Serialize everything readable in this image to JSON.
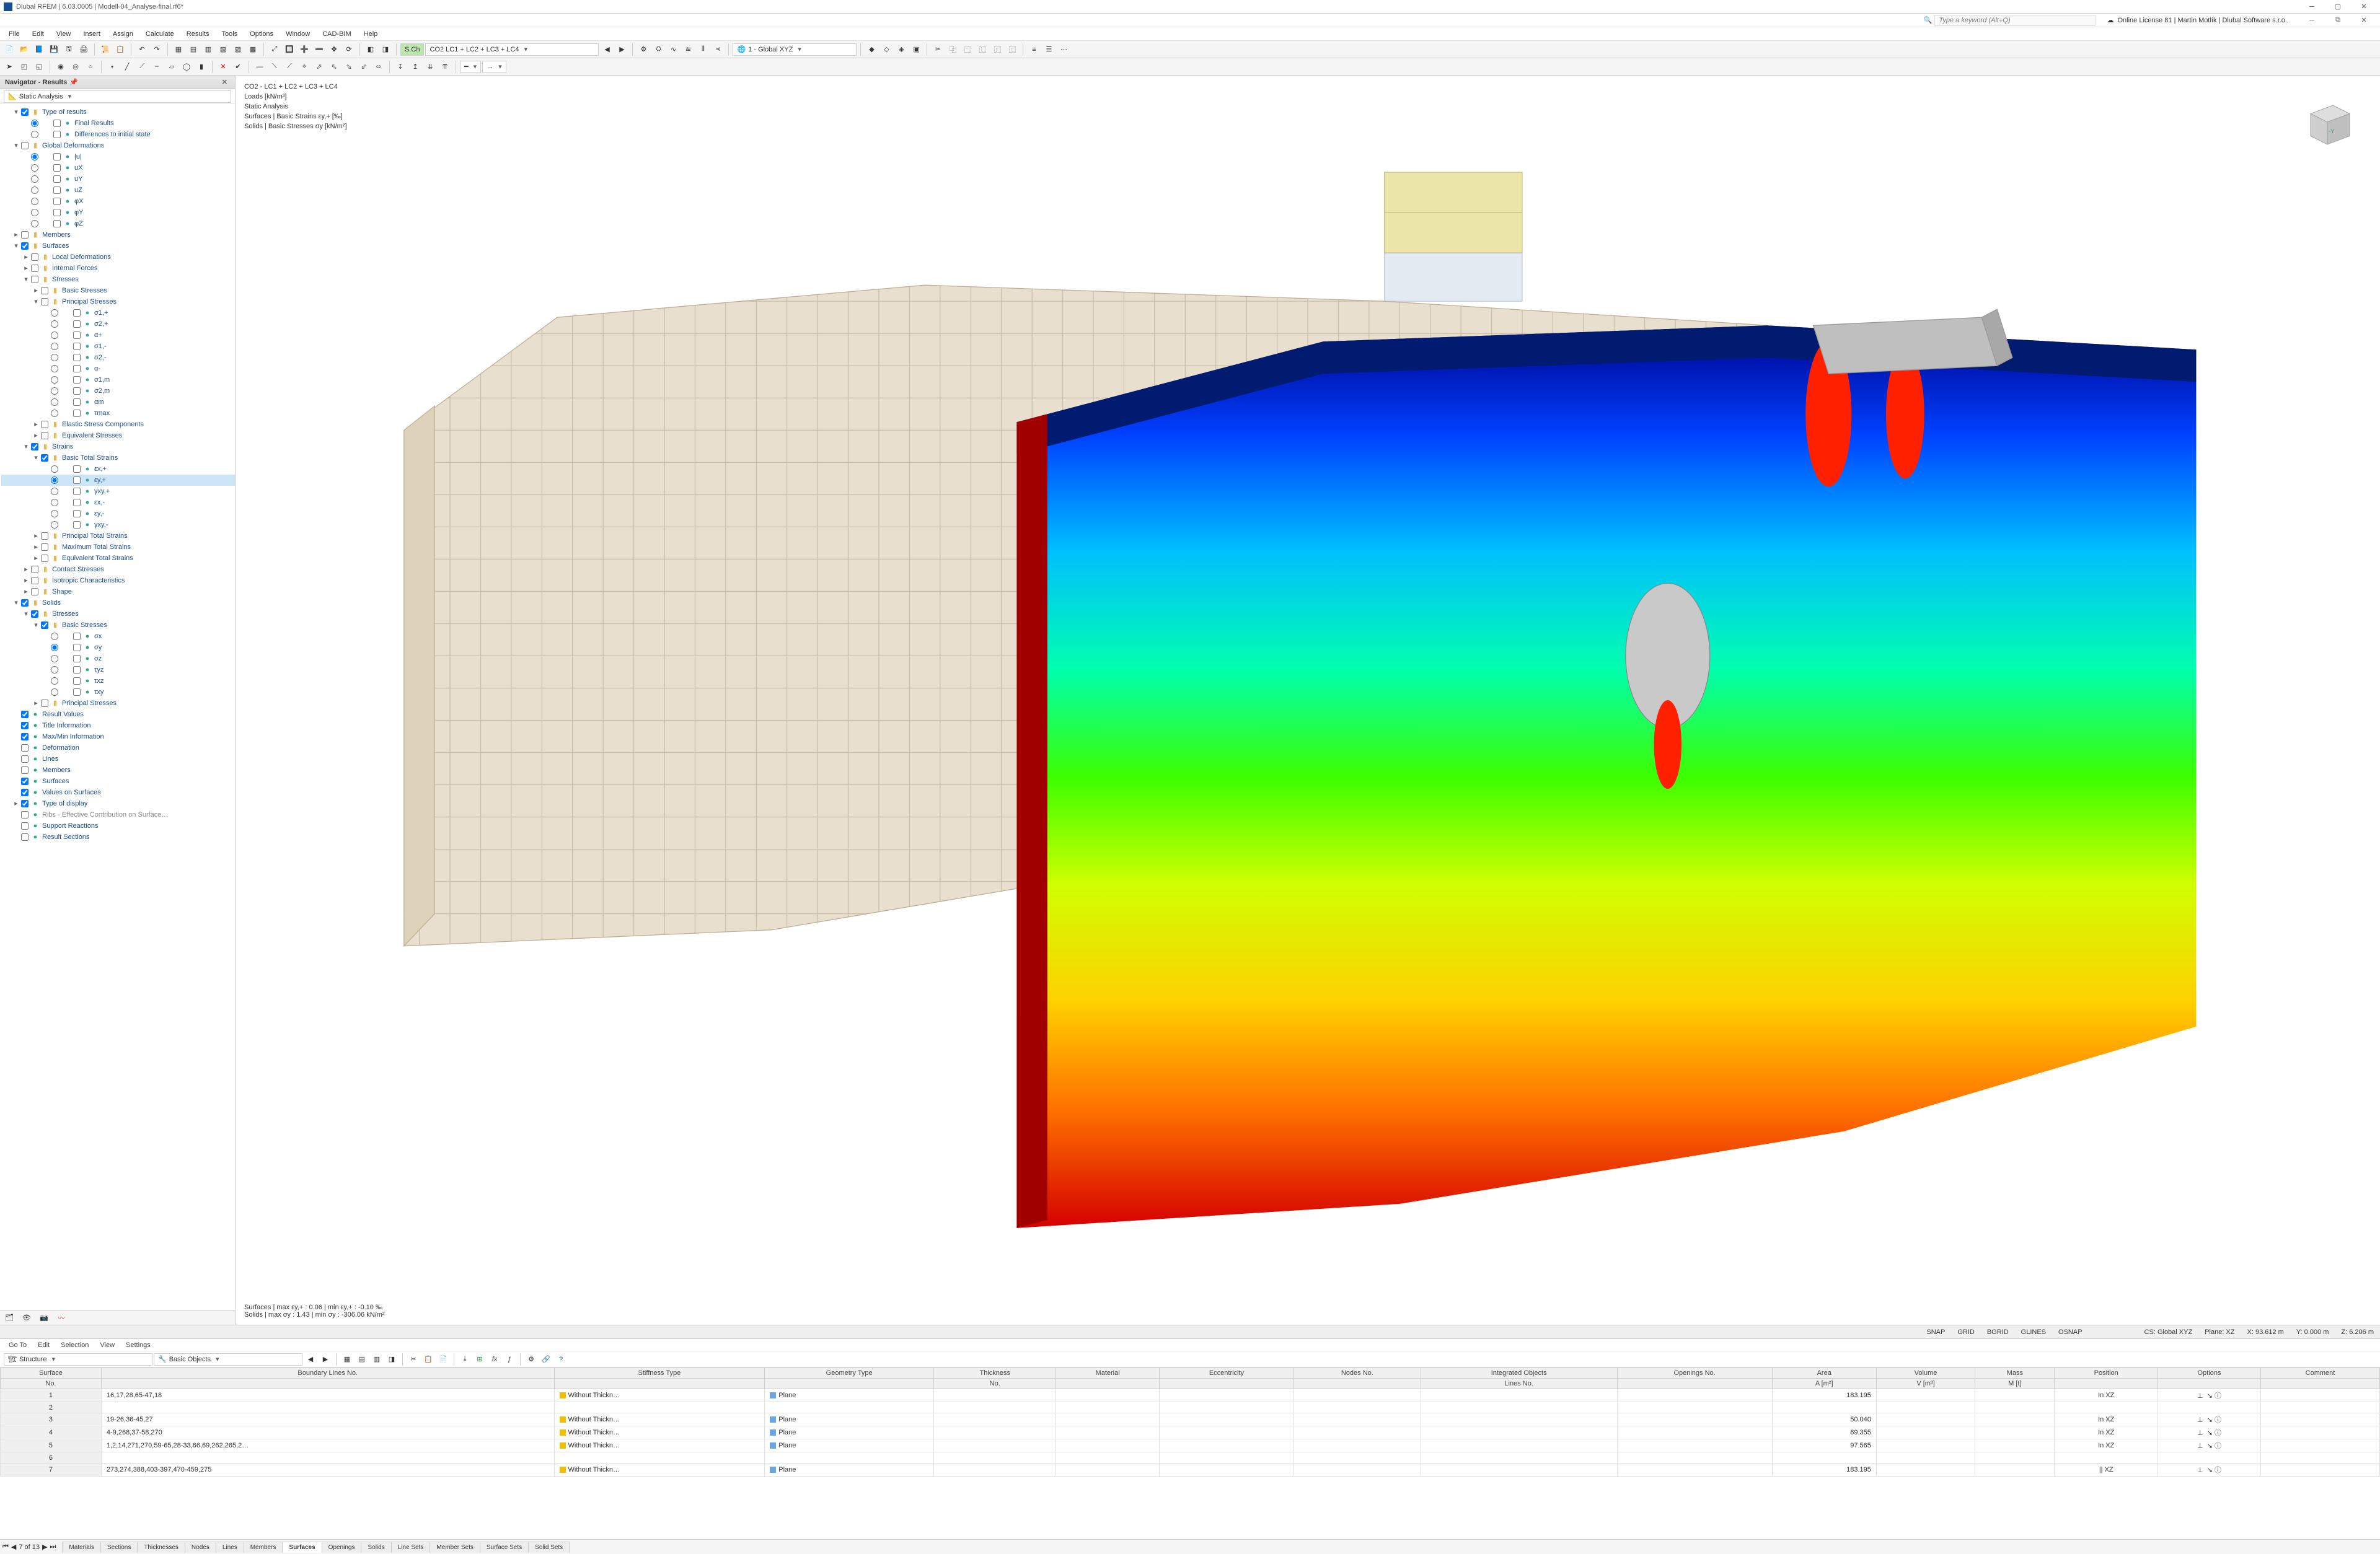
{
  "title": "Dlubal RFEM | 6.03.0005 | Modell-04_Analyse-final.rf6*",
  "subheader_icon": "rfem",
  "search_placeholder": "Type a keyword (Alt+Q)",
  "license": "Online License 81 | Martin Motlík | Dlubal Software s.r.o.",
  "menus": [
    "File",
    "Edit",
    "View",
    "Insert",
    "Assign",
    "Calculate",
    "Results",
    "Tools",
    "Options",
    "Window",
    "CAD-BIM",
    "Help"
  ],
  "combo_loadcase_prefix": "S.Ch",
  "combo_loadcase": "CO2   LC1 + LC2 + LC3 + LC4",
  "combo_coord": "1 - Global XYZ",
  "nav_title": "Navigator - Results",
  "nav_selector": "Static Analysis",
  "overlay": {
    "l1": "CO2 - LC1 + LC2 + LC3 + LC4",
    "l2": "Loads [kN/m³]",
    "l3": "Static Analysis",
    "l4": "Surfaces | Basic Strains εy,+  [‰]",
    "l5": "Solids | Basic Stresses σy  [kN/m²]"
  },
  "overlay_bottom": {
    "l1": "Surfaces | max εy,+ : 0.06 | min εy,+ : -0.10 ‰",
    "l2": "Solids | max σy : 1.43 | min σy : -306.06 kN/m²"
  },
  "tree": [
    {
      "d": 1,
      "exp": "-",
      "chk": true,
      "ic": "folder",
      "txt": "Type of results"
    },
    {
      "d": 2,
      "rad": true,
      "ic": "dot-blue",
      "txt": "Final Results"
    },
    {
      "d": 2,
      "rad": false,
      "ic": "dot-blue",
      "txt": "Differences to initial state"
    },
    {
      "d": 1,
      "exp": "-",
      "chk": false,
      "ic": "folder",
      "txt": "Global Deformations"
    },
    {
      "d": 2,
      "rad": true,
      "raddis": false,
      "txt": "|u|"
    },
    {
      "d": 2,
      "rad": false,
      "txt": "uX"
    },
    {
      "d": 2,
      "rad": false,
      "txt": "uY"
    },
    {
      "d": 2,
      "rad": false,
      "txt": "uZ"
    },
    {
      "d": 2,
      "rad": false,
      "txt": "φX"
    },
    {
      "d": 2,
      "rad": false,
      "txt": "φY"
    },
    {
      "d": 2,
      "rad": false,
      "txt": "φZ"
    },
    {
      "d": 1,
      "exp": "+",
      "chk": false,
      "ic": "folder",
      "txt": "Members"
    },
    {
      "d": 1,
      "exp": "-",
      "chk": true,
      "ic": "folder",
      "txt": "Surfaces"
    },
    {
      "d": 2,
      "exp": "+",
      "chk": false,
      "ic": "folder",
      "txt": "Local Deformations"
    },
    {
      "d": 2,
      "exp": "+",
      "chk": false,
      "ic": "folder",
      "txt": "Internal Forces"
    },
    {
      "d": 2,
      "exp": "-",
      "chk": false,
      "ic": "folder",
      "txt": "Stresses"
    },
    {
      "d": 3,
      "exp": "+",
      "chk": false,
      "ic": "folder",
      "txt": "Basic Stresses"
    },
    {
      "d": 3,
      "exp": "-",
      "chk": false,
      "ic": "folder",
      "txt": "Principal Stresses"
    },
    {
      "d": 4,
      "rad": false,
      "ic": "dot-g",
      "txt": "σ1,+"
    },
    {
      "d": 4,
      "rad": false,
      "ic": "dot-g",
      "txt": "σ2,+"
    },
    {
      "d": 4,
      "rad": false,
      "ic": "dot-g",
      "txt": "α+"
    },
    {
      "d": 4,
      "rad": false,
      "ic": "dot-g",
      "txt": "σ1,-"
    },
    {
      "d": 4,
      "rad": false,
      "ic": "dot-g",
      "txt": "σ2,-"
    },
    {
      "d": 4,
      "rad": false,
      "ic": "dot-g",
      "txt": "α-"
    },
    {
      "d": 4,
      "rad": false,
      "ic": "dot-g",
      "txt": "σ1,m"
    },
    {
      "d": 4,
      "rad": false,
      "ic": "dot-g",
      "txt": "σ2,m"
    },
    {
      "d": 4,
      "rad": false,
      "ic": "dot-g",
      "txt": "αm"
    },
    {
      "d": 4,
      "rad": false,
      "ic": "dot-g",
      "txt": "τmax"
    },
    {
      "d": 3,
      "exp": "+",
      "chk": false,
      "ic": "folder",
      "txt": "Elastic Stress Components"
    },
    {
      "d": 3,
      "exp": "+",
      "chk": false,
      "ic": "folder",
      "txt": "Equivalent Stresses"
    },
    {
      "d": 2,
      "exp": "-",
      "chk": true,
      "ic": "folder",
      "txt": "Strains"
    },
    {
      "d": 3,
      "exp": "-",
      "chk": true,
      "ic": "folder",
      "txt": "Basic Total Strains"
    },
    {
      "d": 4,
      "rad": false,
      "ic": "dot-g",
      "txt": "εx,+"
    },
    {
      "d": 4,
      "rad": true,
      "ic": "dot-g",
      "txt": "εy,+",
      "sel": true
    },
    {
      "d": 4,
      "rad": false,
      "ic": "dot-g",
      "txt": "γxy,+"
    },
    {
      "d": 4,
      "rad": false,
      "ic": "dot-g",
      "txt": "εx,-"
    },
    {
      "d": 4,
      "rad": false,
      "ic": "dot-g",
      "txt": "εy,-"
    },
    {
      "d": 4,
      "rad": false,
      "ic": "dot-g",
      "txt": "γxy,-"
    },
    {
      "d": 3,
      "exp": "+",
      "chk": false,
      "ic": "folder",
      "txt": "Principal Total Strains"
    },
    {
      "d": 3,
      "exp": "+",
      "chk": false,
      "ic": "folder",
      "txt": "Maximum Total Strains"
    },
    {
      "d": 3,
      "exp": "+",
      "chk": false,
      "ic": "folder",
      "txt": "Equivalent Total Strains"
    },
    {
      "d": 2,
      "exp": "+",
      "chk": false,
      "ic": "folder",
      "txt": "Contact Stresses"
    },
    {
      "d": 2,
      "exp": "+",
      "chk": false,
      "ic": "folder",
      "txt": "Isotropic Characteristics"
    },
    {
      "d": 2,
      "exp": "+",
      "chk": false,
      "ic": "folder",
      "txt": "Shape"
    },
    {
      "d": 1,
      "exp": "-",
      "chk": true,
      "ic": "folder",
      "txt": "Solids"
    },
    {
      "d": 2,
      "exp": "-",
      "chk": true,
      "ic": "folder",
      "txt": "Stresses"
    },
    {
      "d": 3,
      "exp": "-",
      "chk": true,
      "ic": "folder",
      "txt": "Basic Stresses"
    },
    {
      "d": 4,
      "rad": false,
      "ic": "dot-b",
      "txt": "σx"
    },
    {
      "d": 4,
      "rad": true,
      "ic": "dot-b",
      "txt": "σy"
    },
    {
      "d": 4,
      "rad": false,
      "ic": "dot-b",
      "txt": "σz"
    },
    {
      "d": 4,
      "rad": false,
      "ic": "dot-b",
      "txt": "τyz"
    },
    {
      "d": 4,
      "rad": false,
      "ic": "dot-b",
      "txt": "τxz"
    },
    {
      "d": 4,
      "rad": false,
      "ic": "dot-b",
      "txt": "τxy"
    },
    {
      "d": 3,
      "exp": "+",
      "chk": false,
      "ic": "folder",
      "txt": "Principal Stresses"
    },
    {
      "d": 1,
      "chk": true,
      "ic": "tag",
      "txt": "Result Values"
    },
    {
      "d": 1,
      "chk": true,
      "ic": "tag",
      "txt": "Title Information"
    },
    {
      "d": 1,
      "chk": true,
      "ic": "tag",
      "txt": "Max/Min Information"
    },
    {
      "d": 1,
      "chk": false,
      "ic": "tag",
      "txt": "Deformation"
    },
    {
      "d": 1,
      "chk": false,
      "ic": "tag",
      "txt": "Lines"
    },
    {
      "d": 1,
      "chk": false,
      "ic": "tag",
      "txt": "Members"
    },
    {
      "d": 1,
      "chk": true,
      "ic": "tag",
      "txt": "Surfaces"
    },
    {
      "d": 1,
      "chk": true,
      "ic": "tag",
      "txt": "Values on Surfaces"
    },
    {
      "d": 1,
      "exp": "+",
      "chk": true,
      "ic": "tag",
      "txt": "Type of display"
    },
    {
      "d": 1,
      "chk": false,
      "ic": "tag",
      "txt": "Ribs - Effective Contribution on Surface…",
      "gray": true
    },
    {
      "d": 1,
      "chk": false,
      "ic": "tag",
      "txt": "Support Reactions"
    },
    {
      "d": 1,
      "chk": false,
      "ic": "tag",
      "txt": "Result Sections"
    }
  ],
  "panel": {
    "title": "Surfaces",
    "menus": [
      "Go To",
      "Edit",
      "Selection",
      "View",
      "Settings"
    ],
    "structure_lbl": "Structure",
    "basic_lbl": "Basic Objects",
    "headers_top": [
      "Surface",
      "Boundary Lines No.",
      "Stiffness Type",
      "Geometry Type",
      "Thickness",
      "Material",
      "Eccentricity",
      "Nodes No.",
      "Integrated Objects",
      "Openings No.",
      "Area",
      "Volume",
      "Mass",
      "Position",
      "Options",
      "Comment"
    ],
    "headers_sub": {
      "Surface": "No.",
      "Thickness": "No.",
      "Integrated Objects": "Lines No.",
      "Area": "A [m²]",
      "Volume": "V [m³]",
      "Mass": "M [t]"
    },
    "rows": [
      {
        "no": "1",
        "bl": "16,17,28,65-47,18",
        "st": "Without Thickn…",
        "stc": "#f0c000",
        "gt": "Plane",
        "gtc": "#6aa6e0",
        "area": "183.195",
        "pos": "In XZ"
      },
      {
        "no": "2"
      },
      {
        "no": "3",
        "bl": "19-26,36-45,27",
        "st": "Without Thickn…",
        "stc": "#f0c000",
        "gt": "Plane",
        "gtc": "#6aa6e0",
        "area": "50.040",
        "pos": "In XZ"
      },
      {
        "no": "4",
        "bl": "4-9,268,37-58,270",
        "st": "Without Thickn…",
        "stc": "#f0c000",
        "gt": "Plane",
        "gtc": "#6aa6e0",
        "area": "69.355",
        "pos": "In XZ"
      },
      {
        "no": "5",
        "bl": "1,2,14,271,270,59-65,28-33,66,69,262,265,2…",
        "st": "Without Thickn…",
        "stc": "#f0c000",
        "gt": "Plane",
        "gtc": "#6aa6e0",
        "area": "97.565",
        "pos": "In XZ"
      },
      {
        "no": "6"
      },
      {
        "no": "7",
        "bl": "273,274,388,403-397,470-459,275",
        "st": "Without Thickn…",
        "stc": "#f0c000",
        "gt": "Plane",
        "gtc": "#6aa6e0",
        "area": "183.195",
        "pos": "|| XZ"
      }
    ],
    "nav_text": "7 of 13",
    "tabs": [
      "Materials",
      "Sections",
      "Thicknesses",
      "Nodes",
      "Lines",
      "Members",
      "Surfaces",
      "Openings",
      "Solids",
      "Line Sets",
      "Member Sets",
      "Surface Sets",
      "Solid Sets"
    ],
    "active_tab": "Surfaces"
  },
  "status": {
    "snap": "SNAP",
    "grid": "GRID",
    "bgrid": "BGRID",
    "glines": "GLINES",
    "osnap": "OSNAP",
    "cs": "CS: Global XYZ",
    "plane": "Plane: XZ",
    "x": "X: 93.612 m",
    "y": "Y: 0.000 m",
    "z": "Z: 6.206 m"
  }
}
